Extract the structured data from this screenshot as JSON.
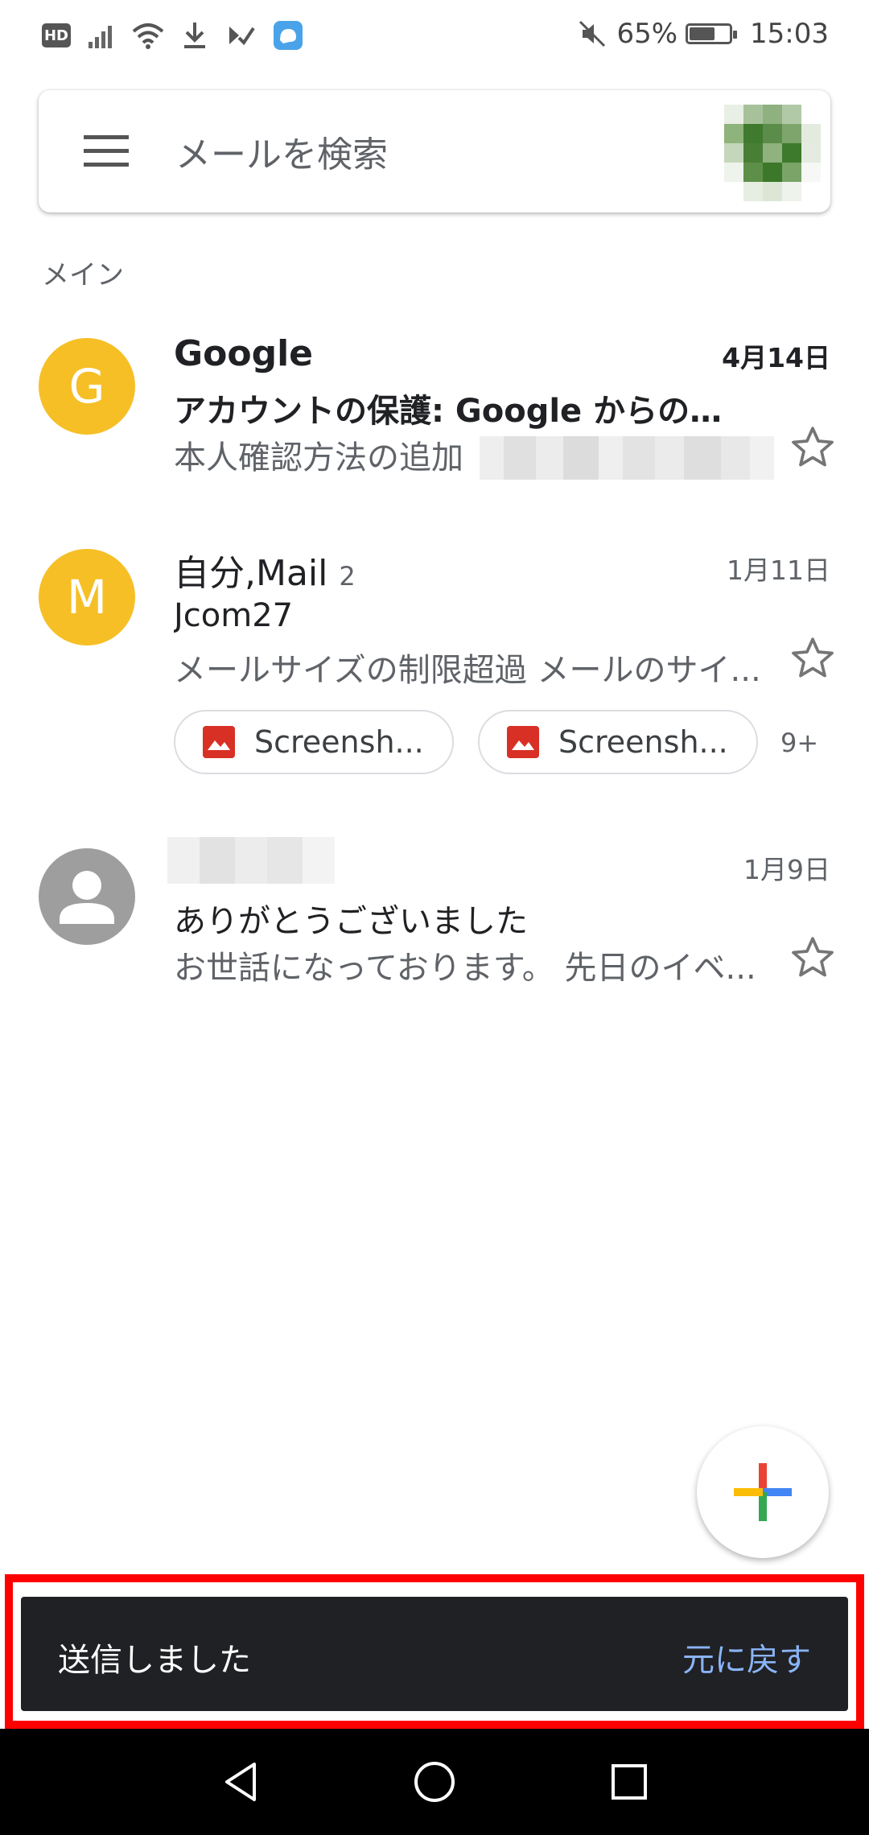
{
  "status_bar": {
    "hd_label": "HD",
    "icons": [
      "hd-icon",
      "signal-icon",
      "wifi-icon",
      "download-icon",
      "notification-icon",
      "app-icon",
      "mute-icon",
      "battery-icon"
    ],
    "battery_percent": "65%",
    "battery_level": 0.65,
    "time": "15:03"
  },
  "search": {
    "placeholder": "メールを検索",
    "menu_icon": "hamburger-menu-icon",
    "account_icon": "account-avatar"
  },
  "section": {
    "label": "メイン"
  },
  "mails": [
    {
      "avatar_letter": "G",
      "avatar_color": "#f6bf26",
      "sender": "Google",
      "date": "4月14日",
      "subject": "アカウントの保護: Google からのセ...",
      "snippet": "本人確認方法の追加",
      "unread": true,
      "starred": false
    },
    {
      "avatar_letter": "M",
      "avatar_color": "#f6bf26",
      "sender": "自分,Mail",
      "count": "2",
      "date": "1月11日",
      "subject": "Jcom27",
      "snippet": "メールサイズの制限超過 メールのサイ...",
      "attachments": [
        "Screensh...",
        "Screensh..."
      ],
      "more_attachments": "9+",
      "unread": false,
      "starred": false
    },
    {
      "avatar_icon": "person-icon",
      "avatar_color": "#9e9e9e",
      "date": "1月9日",
      "subject": "ありがとうございました",
      "snippet": "お世話になっております。 先日のイベ...",
      "unread": false,
      "starred": false
    }
  ],
  "fab": {
    "icon": "compose-plus-icon",
    "colors": [
      "#ea4335",
      "#4285f4",
      "#34a853",
      "#fbbc05"
    ]
  },
  "snackbar": {
    "message": "送信しました",
    "action": "元に戻す",
    "action_color": "#8ab4f8",
    "highlight_color": "#ff0000"
  },
  "nav_bar": {
    "buttons": [
      "back-icon",
      "home-icon",
      "recents-icon"
    ]
  }
}
